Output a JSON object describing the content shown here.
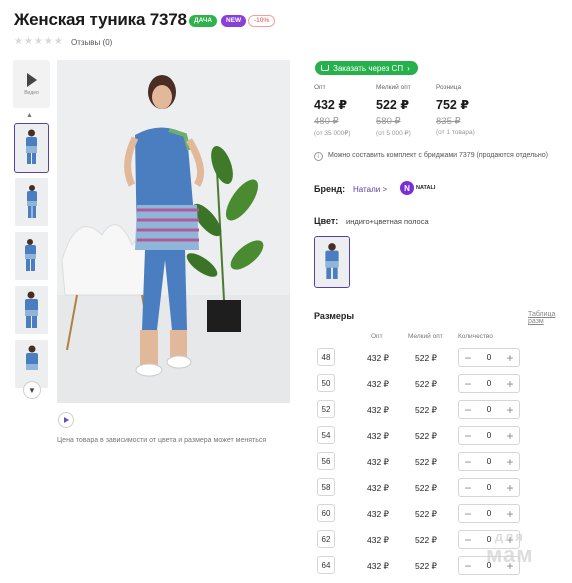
{
  "product": {
    "title": "Женская туника 7378",
    "badges": {
      "dacha": "ДАЧА",
      "new": "NEW",
      "sale": "-10%"
    },
    "rating_stars": 0,
    "reviews_label": "Отзывы (0)"
  },
  "gallery": {
    "video_label": "Видео",
    "price_note": "Цена товара в зависимости от цвета и размера может меняться"
  },
  "sp_button_label": "Заказать через СП",
  "prices": [
    {
      "label": "Опт",
      "price": "432 ₽",
      "old": "480 ₽",
      "note": "(от 35 000₽)"
    },
    {
      "label": "Мелкий опт",
      "price": "522 ₽",
      "old": "580 ₽",
      "note": "(от 5 000 ₽)"
    },
    {
      "label": "Розница",
      "price": "752 ₽",
      "old": "835 ₽",
      "note": "(от 1 товара)"
    }
  ],
  "info_text": "Можно составить комплект с бриджами 7379 (продаются отдельно)",
  "brand": {
    "label": "Бренд:",
    "name": "Натали",
    "chevron": ">",
    "logo_letter": "N",
    "logo_text": "NATALI"
  },
  "color": {
    "label": "Цвет:",
    "value": "индиго+цветная полоса"
  },
  "sizes": {
    "label": "Размеры",
    "table_link": "Таблица разм",
    "headers": {
      "opt": "Опт",
      "small_opt": "Мелкий опт",
      "qty": "Количество"
    },
    "rows": [
      {
        "size": "48",
        "opt": "432 ₽",
        "small_opt": "522 ₽",
        "qty": "0"
      },
      {
        "size": "50",
        "opt": "432 ₽",
        "small_opt": "522 ₽",
        "qty": "0"
      },
      {
        "size": "52",
        "opt": "432 ₽",
        "small_opt": "522 ₽",
        "qty": "0"
      },
      {
        "size": "54",
        "opt": "432 ₽",
        "small_opt": "522 ₽",
        "qty": "0"
      },
      {
        "size": "56",
        "opt": "432 ₽",
        "small_opt": "522 ₽",
        "qty": "0"
      },
      {
        "size": "58",
        "opt": "432 ₽",
        "small_opt": "522 ₽",
        "qty": "0"
      },
      {
        "size": "60",
        "opt": "432 ₽",
        "small_opt": "522 ₽",
        "qty": "0"
      },
      {
        "size": "62",
        "opt": "432 ₽",
        "small_opt": "522 ₽",
        "qty": "0"
      },
      {
        "size": "64",
        "opt": "432 ₽",
        "small_opt": "522 ₽",
        "qty": "0"
      }
    ]
  },
  "watermark": {
    "line1": "для",
    "line2": "мам"
  },
  "colors": {
    "accent": "#5b3fa8",
    "green": "#27b14c",
    "badge_new": "#8a3fd6",
    "sale": "#e54545",
    "tunic_blue": "#4b7ec0"
  }
}
